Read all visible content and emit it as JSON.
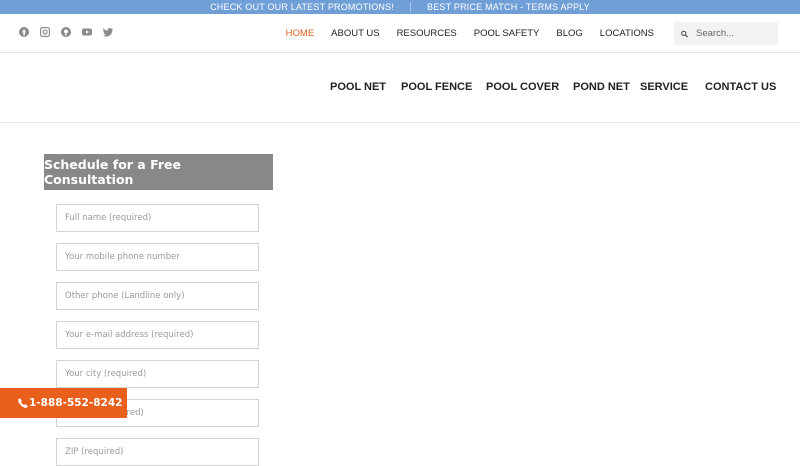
{
  "promo": {
    "left_text": "CHECK OUT OUR LATEST PROMOTIONS!",
    "right_text": "BEST PRICE MATCH - TERMS APPLY"
  },
  "social": [
    "facebook-icon",
    "instagram-icon",
    "pinterest-icon",
    "youtube-icon",
    "twitter-icon"
  ],
  "top_nav": {
    "home": "HOME",
    "about": "ABOUT US",
    "resources": "RESOURCES",
    "pool_safety": "POOL SAFETY",
    "blog": "BLOG",
    "locations": "LOCATIONS"
  },
  "search": {
    "placeholder": "Search..."
  },
  "main_nav": {
    "pool_net": "POOL NET",
    "pool_fence": "POOL FENCE",
    "pool_cover": "POOL COVER",
    "pond_net": "POND NET",
    "service": "SERVICE",
    "contact": "CONTACT US"
  },
  "form": {
    "title": "Schedule for a Free Consultation",
    "full_name": "Full name (required)",
    "mobile": "Your mobile phone number",
    "other_phone": "Other phone (Landline only)",
    "email": "Your e-mail address (required)",
    "city": "Your city (required)",
    "address": "Address (required)",
    "zip": "ZIP (required)"
  },
  "phone_button": {
    "label": "1-888-552-8242"
  },
  "colors": {
    "promo_bar": "#6f9fd6",
    "accent": "#e25c1f",
    "phone_button": "#e8601c",
    "form_title_bg": "#888888"
  }
}
